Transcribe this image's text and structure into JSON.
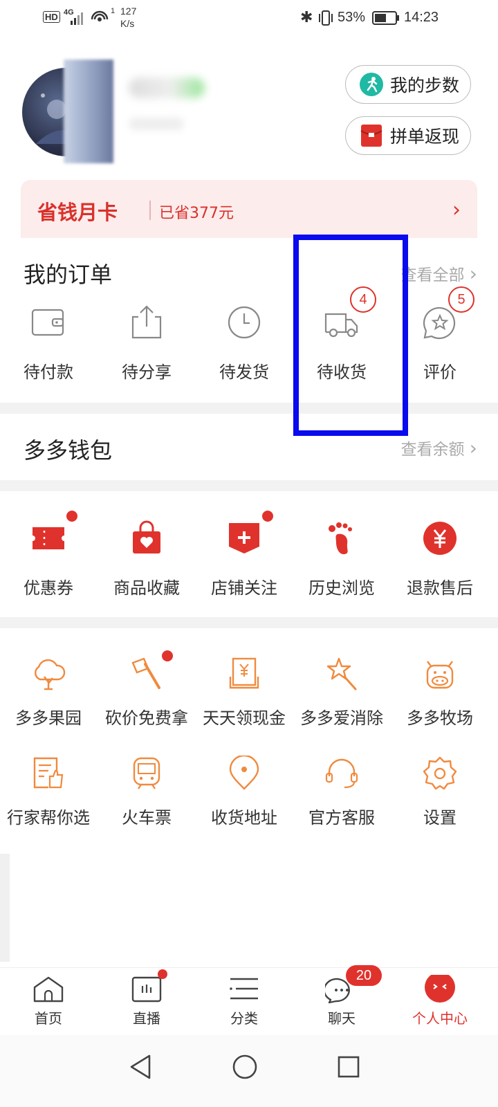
{
  "status_bar": {
    "hd": "HD",
    "network": "4G",
    "speed_num": "127",
    "speed_unit": "K/s",
    "battery": "53%",
    "time": "14:23"
  },
  "header": {
    "steps_button": "我的步数",
    "cashback_button": "拼单返现"
  },
  "savings_card": {
    "title": "省钱月卡",
    "saved": "已省377元"
  },
  "orders": {
    "title": "我的订单",
    "view_all": "查看全部",
    "items": [
      {
        "label": "待付款",
        "icon": "wallet-icon"
      },
      {
        "label": "待分享",
        "icon": "share-icon"
      },
      {
        "label": "待发货",
        "icon": "clock-icon"
      },
      {
        "label": "待收货",
        "icon": "truck-icon",
        "badge": "4"
      },
      {
        "label": "评价",
        "icon": "review-icon",
        "badge": "5"
      }
    ]
  },
  "wallet": {
    "title": "多多钱包",
    "view_balance": "查看余额"
  },
  "shortcuts": [
    {
      "label": "优惠券",
      "icon": "coupon-icon",
      "dot": true
    },
    {
      "label": "商品收藏",
      "icon": "favorite-bag-icon",
      "dot": false
    },
    {
      "label": "店铺关注",
      "icon": "store-follow-icon",
      "dot": true
    },
    {
      "label": "历史浏览",
      "icon": "footprint-icon",
      "dot": false
    },
    {
      "label": "退款售后",
      "icon": "refund-icon",
      "dot": false
    }
  ],
  "services_row1": [
    {
      "label": "多多果园",
      "icon": "tree-icon"
    },
    {
      "label": "砍价免费拿",
      "icon": "axe-icon"
    },
    {
      "label": "天天领现金",
      "icon": "cash-icon"
    },
    {
      "label": "多多爱消除",
      "icon": "star-wand-icon"
    },
    {
      "label": "多多牧场",
      "icon": "cow-icon"
    }
  ],
  "services_row2": [
    {
      "label": "行家帮你选",
      "icon": "thumbs-up-doc-icon"
    },
    {
      "label": "火车票",
      "icon": "train-icon"
    },
    {
      "label": "收货地址",
      "icon": "location-icon"
    },
    {
      "label": "官方客服",
      "icon": "headset-icon"
    },
    {
      "label": "设置",
      "icon": "gear-icon"
    }
  ],
  "bottom_nav": [
    {
      "label": "首页",
      "icon": "home-icon"
    },
    {
      "label": "直播",
      "icon": "live-icon"
    },
    {
      "label": "分类",
      "icon": "category-icon"
    },
    {
      "label": "聊天",
      "icon": "chat-icon",
      "badge": "20"
    },
    {
      "label": "个人中心",
      "icon": "profile-icon",
      "active": true
    }
  ],
  "colors": {
    "accent": "#e0322c",
    "orange_icon": "#f08a3e",
    "highlight": "#0a0aee"
  }
}
